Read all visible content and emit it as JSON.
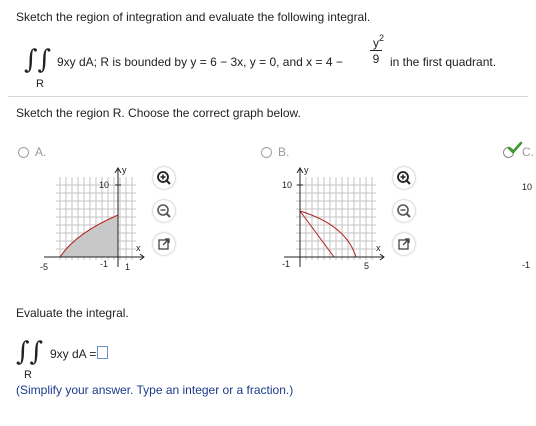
{
  "problem": {
    "instruction": "Sketch the region of integration and evaluate the following integral.",
    "integrand": "9xy dA; R is bounded by y = 6 − 3x, y = 0, and x = 4 −",
    "frac_num": "y",
    "frac_exp": "2",
    "frac_den": "9",
    "tail": "in the first quadrant.",
    "region_sub": "R"
  },
  "sketch": {
    "prompt": "Sketch the region R. Choose the correct graph below."
  },
  "options": [
    {
      "label": "A.",
      "selected": false,
      "graph": {
        "ytick": "10",
        "xtick_neg": "-5",
        "ytick_neg": "-1",
        "xtick_pos": "1",
        "y_axis": "y",
        "x_axis": "x"
      }
    },
    {
      "label": "B.",
      "selected": false,
      "graph": {
        "ytick": "10",
        "ytick_neg": "-1",
        "xtick_pos": "5",
        "y_axis": "y",
        "x_axis": "x"
      }
    },
    {
      "label": "C.",
      "selected": true,
      "graph": {
        "ytick": "10",
        "ytick_neg": "-1"
      }
    }
  ],
  "evaluate": {
    "prompt": "Evaluate the integral.",
    "integrand": "9xy dA =",
    "region_sub": "R",
    "answer_value": "",
    "hint": "(Simplify your answer. Type an integer or a fraction.)"
  },
  "icons": {
    "zoom_in": "zoom-in-icon",
    "zoom_out": "zoom-out-icon",
    "popout": "popout-icon",
    "check": "check-icon"
  },
  "colors": {
    "accent_blue": "#1a3a8a",
    "region_red": "#b22222",
    "region_fill": "#c8c8c8",
    "check_green": "#3a9a2a"
  }
}
